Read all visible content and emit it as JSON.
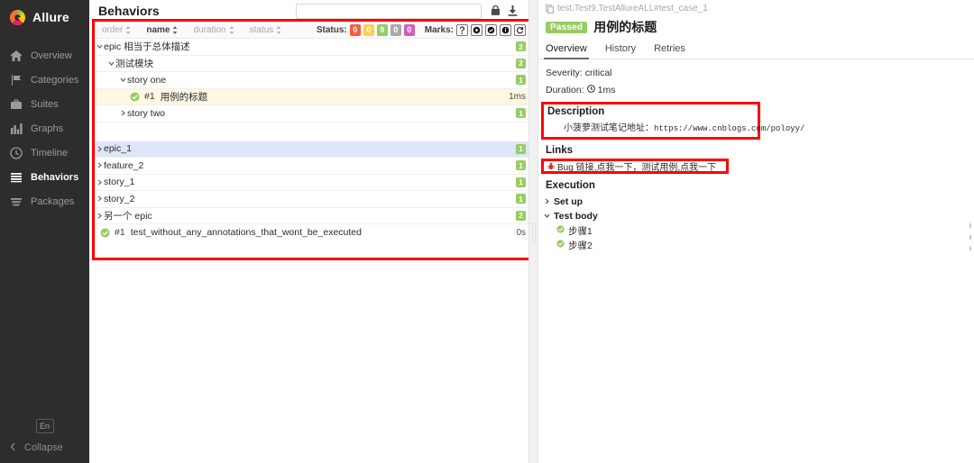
{
  "sidebar": {
    "brand": "Allure",
    "items": [
      {
        "label": "Overview",
        "icon": "home-icon"
      },
      {
        "label": "Categories",
        "icon": "flag-icon"
      },
      {
        "label": "Suites",
        "icon": "briefcase-icon"
      },
      {
        "label": "Graphs",
        "icon": "bar-chart-icon"
      },
      {
        "label": "Timeline",
        "icon": "clock-icon"
      },
      {
        "label": "Behaviors",
        "icon": "list-icon"
      },
      {
        "label": "Packages",
        "icon": "layers-icon"
      }
    ],
    "active": "Behaviors",
    "language_button": "En",
    "collapse_label": "Collapse"
  },
  "left_pane": {
    "title": "Behaviors",
    "search_value": "",
    "search_placeholder": "",
    "header_icons": [
      "info-icon",
      "download-icon"
    ],
    "sort_columns": [
      {
        "label": "order",
        "active": false
      },
      {
        "label": "name",
        "active": true
      },
      {
        "label": "duration",
        "active": false
      },
      {
        "label": "status",
        "active": false
      }
    ],
    "status_label": "Status:",
    "status_badges": [
      {
        "value": "0",
        "color": "#fd5a3e"
      },
      {
        "value": "0",
        "color": "#ffd050"
      },
      {
        "value": "9",
        "color": "#97cc64"
      },
      {
        "value": "0",
        "color": "#aaaaaa"
      },
      {
        "value": "0",
        "color": "#d35ebe"
      }
    ],
    "marks_label": "Marks:",
    "marks": [
      "flaky-icon",
      "unknown-icon",
      "fixed-icon",
      "regression-icon",
      "retry-icon"
    ],
    "rows": [
      {
        "label": "epic 相当于总体描述",
        "indent": 0,
        "type": "group",
        "expanded": true,
        "count": "2",
        "state": "none"
      },
      {
        "label": "测试模块",
        "indent": 1,
        "type": "group",
        "expanded": true,
        "count": "2",
        "state": "none"
      },
      {
        "label": "story one",
        "indent": 2,
        "type": "group",
        "expanded": true,
        "count": "1",
        "state": "none"
      },
      {
        "label": "用例的标题",
        "indent": 3,
        "type": "test",
        "number": "#1",
        "duration": "1ms",
        "state": "yellow"
      },
      {
        "label": "story two",
        "indent": 2,
        "type": "group",
        "expanded": false,
        "count": "1",
        "state": "none"
      },
      {
        "label": "epic_1",
        "indent": 0,
        "type": "group",
        "expanded": false,
        "count": "1",
        "state": "blue"
      },
      {
        "label": "feature_2",
        "indent": 0,
        "type": "group",
        "expanded": false,
        "count": "1",
        "state": "none"
      },
      {
        "label": "story_1",
        "indent": 0,
        "type": "group",
        "expanded": false,
        "count": "1",
        "state": "none"
      },
      {
        "label": "story_2",
        "indent": 0,
        "type": "group",
        "expanded": false,
        "count": "1",
        "state": "none"
      },
      {
        "label": "另一个 epic",
        "indent": 0,
        "type": "group",
        "expanded": false,
        "count": "2",
        "state": "none"
      },
      {
        "label": "test_without_any_annotations_that_wont_be_executed",
        "indent": 0,
        "type": "test",
        "number": "#1",
        "duration": "0s",
        "state": "none"
      }
    ]
  },
  "right_pane": {
    "breadcrumb": "test.Test9.TestAllureALL#test_case_1",
    "status_badge": "Passed",
    "title": "用例的标题",
    "tabs": [
      {
        "label": "Overview",
        "active": true
      },
      {
        "label": "History",
        "active": false
      },
      {
        "label": "Retries",
        "active": false
      }
    ],
    "severity": "Severity: critical",
    "duration_label": "Duration:",
    "duration_value": "1ms",
    "description_heading": "Description",
    "description_text": "小菠萝测试笔记地址：",
    "description_url": "https://www.cnblogs.com/poloyy/",
    "links_heading": "Links",
    "link_text": "Bug 链接,点我一下，测试用例,点我一下",
    "execution_heading": "Execution",
    "execution_rows": [
      {
        "label": "Set up",
        "expanded": false,
        "status": "none"
      },
      {
        "label": "Test body",
        "expanded": true,
        "status": "none"
      }
    ],
    "steps": [
      {
        "label": "步骤1",
        "status": "passed"
      },
      {
        "label": "步骤2",
        "status": "passed"
      }
    ]
  },
  "colors": {
    "accent_green": "#97cc64",
    "highlight_red": "#ff0000",
    "selected_blue": "#dde6f7",
    "selected_yellow": "#fcf8e3",
    "sidebar_bg": "#2d2d2d"
  }
}
